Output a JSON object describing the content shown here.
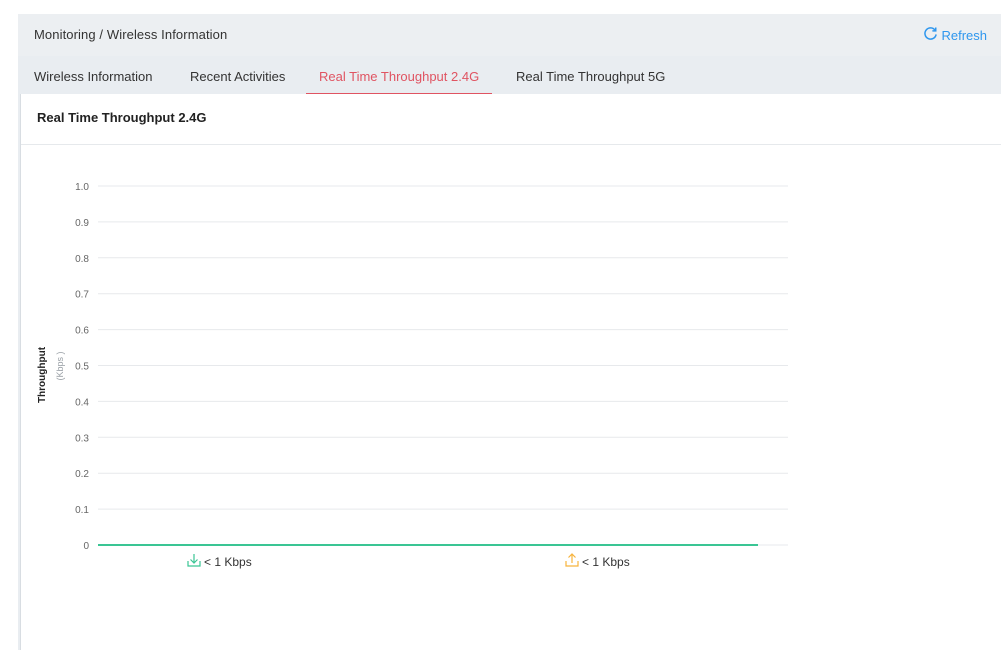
{
  "breadcrumb": "Monitoring / Wireless Information",
  "refresh_label": "Refresh",
  "tabs": [
    {
      "label": "Wireless Information",
      "active": false
    },
    {
      "label": "Recent Activities",
      "active": false
    },
    {
      "label": "Real Time Throughput 2.4G",
      "active": true
    },
    {
      "label": "Real Time Throughput 5G",
      "active": false
    }
  ],
  "panel_title": "Real Time Throughput 2.4G",
  "colors": {
    "accent_active_tab": "#e05462",
    "refresh": "#2f97ee",
    "download": "#3ac594",
    "upload": "#f7b33c",
    "gridline": "#e7e9ec"
  },
  "icons": {
    "refresh": "refresh-icon",
    "download": "download-icon",
    "upload": "upload-icon"
  },
  "chart_data": {
    "type": "line",
    "ylabel": "Throughput",
    "ylabel_unit": "(Kbps )",
    "yticks": [
      "1.0",
      "0.9",
      "0.8",
      "0.7",
      "0.6",
      "0.5",
      "0.4",
      "0.3",
      "0.2",
      "0.1",
      "0"
    ],
    "ylim": [
      0,
      1.0
    ],
    "grid": true,
    "series": [
      {
        "values": [
          0,
          0
        ]
      }
    ],
    "legend": [
      {
        "icon": "download-icon",
        "label": "< 1 Kbps"
      },
      {
        "icon": "upload-icon",
        "label": "< 1 Kbps"
      }
    ]
  }
}
